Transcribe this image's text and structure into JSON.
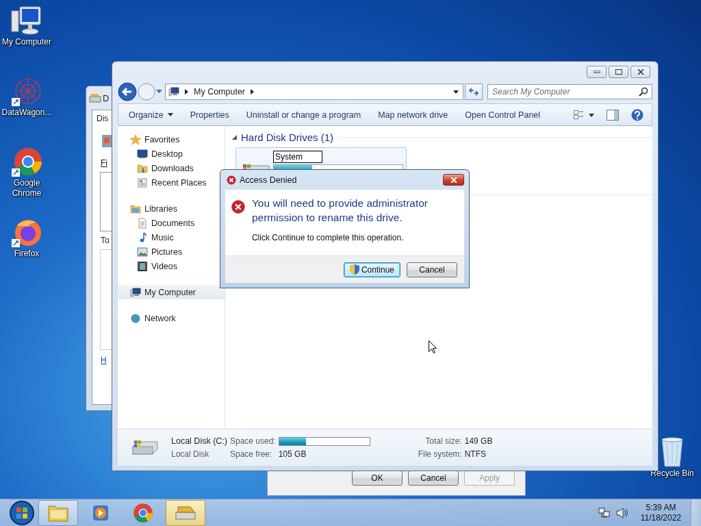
{
  "desktop_icons": [
    {
      "label": "My Computer"
    },
    {
      "label": "DataWagon..."
    },
    {
      "label": "Google Chrome"
    },
    {
      "label": "Firefox"
    }
  ],
  "recycle_bin": {
    "label": "Recycle Bin"
  },
  "background_window": {
    "title": "D",
    "tab": "Dis",
    "label_1": "Fi",
    "label_2": "To",
    "link": "H"
  },
  "back_dialog": {
    "buttons": [
      {
        "label": "OK",
        "disabled": false
      },
      {
        "label": "Cancel",
        "disabled": false
      },
      {
        "label": "Apply",
        "disabled": true
      }
    ]
  },
  "explorer": {
    "address": {
      "segments": [
        "My Computer"
      ]
    },
    "search": {
      "placeholder": "Search My Computer"
    },
    "toolbar": [
      {
        "label": "Organize",
        "dropdown": true
      },
      {
        "label": "Properties",
        "dropdown": false
      },
      {
        "label": "Uninstall or change a program",
        "dropdown": false
      },
      {
        "label": "Map network drive",
        "dropdown": false
      },
      {
        "label": "Open Control Panel",
        "dropdown": false
      }
    ],
    "nav": [
      {
        "label": "Favorites",
        "selected": false,
        "children": [
          {
            "label": "Desktop",
            "selected": false
          },
          {
            "label": "Downloads",
            "selected": false
          },
          {
            "label": "Recent Places",
            "selected": false
          }
        ]
      },
      {
        "label": "Libraries",
        "selected": false,
        "children": [
          {
            "label": "Documents",
            "selected": false
          },
          {
            "label": "Music",
            "selected": false
          },
          {
            "label": "Pictures",
            "selected": false
          },
          {
            "label": "Videos",
            "selected": false
          }
        ]
      },
      {
        "label": "My Computer",
        "selected": true
      },
      {
        "label": "Network",
        "selected": false
      }
    ],
    "group": {
      "title": "Hard Disk Drives (1)",
      "expanded": true,
      "drives": [
        {
          "rename_value": "System",
          "level": 0.3
        }
      ]
    },
    "details": {
      "name": "Local Disk (C:)",
      "type": "Local Disk",
      "space_used_label": "Space used:",
      "level": 0.3,
      "space_free_label": "Space free:",
      "space_free": "105 GB",
      "total_size_label": "Total size:",
      "total_size": "149 GB",
      "file_system_label": "File system:",
      "file_system": "NTFS"
    }
  },
  "dialog": {
    "title": "Access Denied",
    "heading": "You will need to provide administrator permission to rename this drive.",
    "message": "Click Continue to complete this operation.",
    "buttons": [
      {
        "label": "Continue",
        "default": true,
        "shield": true
      },
      {
        "label": "Cancel",
        "default": false,
        "shield": false
      }
    ]
  },
  "taskbar": {
    "items": [
      {
        "running": true,
        "selected": false
      },
      {
        "running": false,
        "selected": false
      },
      {
        "running": false,
        "selected": false
      },
      {
        "running": true,
        "selected": true
      }
    ],
    "clock": {
      "time": "5:39 AM",
      "date": "11/18/2022"
    }
  }
}
